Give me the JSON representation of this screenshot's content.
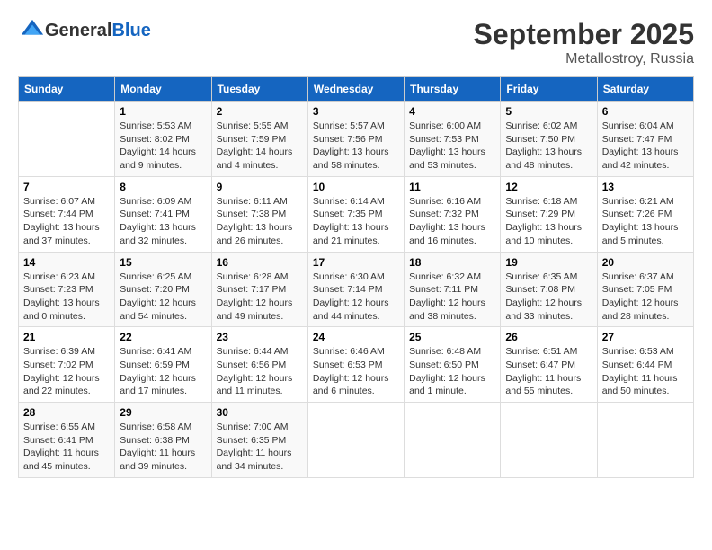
{
  "header": {
    "logo_general": "General",
    "logo_blue": "Blue",
    "title": "September 2025",
    "location": "Metallostroy, Russia"
  },
  "columns": [
    "Sunday",
    "Monday",
    "Tuesday",
    "Wednesday",
    "Thursday",
    "Friday",
    "Saturday"
  ],
  "weeks": [
    [
      {
        "day": "",
        "info": ""
      },
      {
        "day": "1",
        "info": "Sunrise: 5:53 AM\nSunset: 8:02 PM\nDaylight: 14 hours\nand 9 minutes."
      },
      {
        "day": "2",
        "info": "Sunrise: 5:55 AM\nSunset: 7:59 PM\nDaylight: 14 hours\nand 4 minutes."
      },
      {
        "day": "3",
        "info": "Sunrise: 5:57 AM\nSunset: 7:56 PM\nDaylight: 13 hours\nand 58 minutes."
      },
      {
        "day": "4",
        "info": "Sunrise: 6:00 AM\nSunset: 7:53 PM\nDaylight: 13 hours\nand 53 minutes."
      },
      {
        "day": "5",
        "info": "Sunrise: 6:02 AM\nSunset: 7:50 PM\nDaylight: 13 hours\nand 48 minutes."
      },
      {
        "day": "6",
        "info": "Sunrise: 6:04 AM\nSunset: 7:47 PM\nDaylight: 13 hours\nand 42 minutes."
      }
    ],
    [
      {
        "day": "7",
        "info": "Sunrise: 6:07 AM\nSunset: 7:44 PM\nDaylight: 13 hours\nand 37 minutes."
      },
      {
        "day": "8",
        "info": "Sunrise: 6:09 AM\nSunset: 7:41 PM\nDaylight: 13 hours\nand 32 minutes."
      },
      {
        "day": "9",
        "info": "Sunrise: 6:11 AM\nSunset: 7:38 PM\nDaylight: 13 hours\nand 26 minutes."
      },
      {
        "day": "10",
        "info": "Sunrise: 6:14 AM\nSunset: 7:35 PM\nDaylight: 13 hours\nand 21 minutes."
      },
      {
        "day": "11",
        "info": "Sunrise: 6:16 AM\nSunset: 7:32 PM\nDaylight: 13 hours\nand 16 minutes."
      },
      {
        "day": "12",
        "info": "Sunrise: 6:18 AM\nSunset: 7:29 PM\nDaylight: 13 hours\nand 10 minutes."
      },
      {
        "day": "13",
        "info": "Sunrise: 6:21 AM\nSunset: 7:26 PM\nDaylight: 13 hours\nand 5 minutes."
      }
    ],
    [
      {
        "day": "14",
        "info": "Sunrise: 6:23 AM\nSunset: 7:23 PM\nDaylight: 13 hours\nand 0 minutes."
      },
      {
        "day": "15",
        "info": "Sunrise: 6:25 AM\nSunset: 7:20 PM\nDaylight: 12 hours\nand 54 minutes."
      },
      {
        "day": "16",
        "info": "Sunrise: 6:28 AM\nSunset: 7:17 PM\nDaylight: 12 hours\nand 49 minutes."
      },
      {
        "day": "17",
        "info": "Sunrise: 6:30 AM\nSunset: 7:14 PM\nDaylight: 12 hours\nand 44 minutes."
      },
      {
        "day": "18",
        "info": "Sunrise: 6:32 AM\nSunset: 7:11 PM\nDaylight: 12 hours\nand 38 minutes."
      },
      {
        "day": "19",
        "info": "Sunrise: 6:35 AM\nSunset: 7:08 PM\nDaylight: 12 hours\nand 33 minutes."
      },
      {
        "day": "20",
        "info": "Sunrise: 6:37 AM\nSunset: 7:05 PM\nDaylight: 12 hours\nand 28 minutes."
      }
    ],
    [
      {
        "day": "21",
        "info": "Sunrise: 6:39 AM\nSunset: 7:02 PM\nDaylight: 12 hours\nand 22 minutes."
      },
      {
        "day": "22",
        "info": "Sunrise: 6:41 AM\nSunset: 6:59 PM\nDaylight: 12 hours\nand 17 minutes."
      },
      {
        "day": "23",
        "info": "Sunrise: 6:44 AM\nSunset: 6:56 PM\nDaylight: 12 hours\nand 11 minutes."
      },
      {
        "day": "24",
        "info": "Sunrise: 6:46 AM\nSunset: 6:53 PM\nDaylight: 12 hours\nand 6 minutes."
      },
      {
        "day": "25",
        "info": "Sunrise: 6:48 AM\nSunset: 6:50 PM\nDaylight: 12 hours\nand 1 minute."
      },
      {
        "day": "26",
        "info": "Sunrise: 6:51 AM\nSunset: 6:47 PM\nDaylight: 11 hours\nand 55 minutes."
      },
      {
        "day": "27",
        "info": "Sunrise: 6:53 AM\nSunset: 6:44 PM\nDaylight: 11 hours\nand 50 minutes."
      }
    ],
    [
      {
        "day": "28",
        "info": "Sunrise: 6:55 AM\nSunset: 6:41 PM\nDaylight: 11 hours\nand 45 minutes."
      },
      {
        "day": "29",
        "info": "Sunrise: 6:58 AM\nSunset: 6:38 PM\nDaylight: 11 hours\nand 39 minutes."
      },
      {
        "day": "30",
        "info": "Sunrise: 7:00 AM\nSunset: 6:35 PM\nDaylight: 11 hours\nand 34 minutes."
      },
      {
        "day": "",
        "info": ""
      },
      {
        "day": "",
        "info": ""
      },
      {
        "day": "",
        "info": ""
      },
      {
        "day": "",
        "info": ""
      }
    ]
  ]
}
